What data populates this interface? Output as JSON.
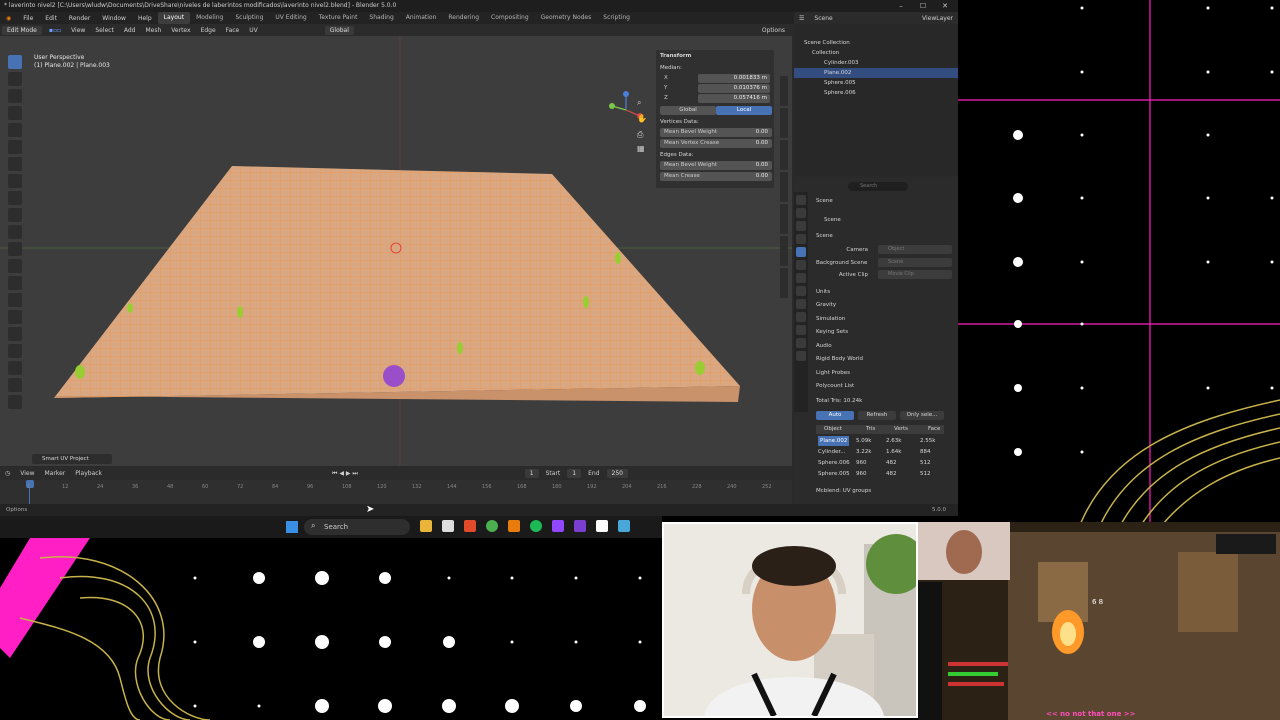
{
  "blender": {
    "title": "* laverinto nivel2 [C:\\Users\\wludw\\Documents\\DriveShare\\niveles de laberintos modificados\\laverinto nivel2.blend] - Blender 5.0.0",
    "menus": [
      "File",
      "Edit",
      "Render",
      "Window",
      "Help"
    ],
    "workspaces": [
      "Layout",
      "Modeling",
      "Sculpting",
      "UV Editing",
      "Texture Paint",
      "Shading",
      "Animation",
      "Rendering",
      "Compositing",
      "Geometry Nodes",
      "Scripting"
    ],
    "active_workspace": "Layout",
    "viewport_header": {
      "mode": "Edit Mode",
      "menus": [
        "View",
        "Select",
        "Add",
        "Mesh",
        "Vertex",
        "Edge",
        "Face",
        "UV"
      ],
      "transform_orientation": "Global",
      "options": "Options"
    },
    "viewport_info": {
      "line1": "User Perspective",
      "line2": "(1) Plane.002 | Plane.003"
    },
    "n_panel": {
      "header": "Transform",
      "median_label": "Median:",
      "x": "0.001833 m",
      "y": "0.010376 m",
      "z": "0.057416 m",
      "global": "Global",
      "local": "Local",
      "vertices_data": "Vertices Data:",
      "mean_bevel_weight_label": "Mean Bevel Weight",
      "mean_bevel_weight": "0.00",
      "mean_vertex_crease_label": "Mean Vertex Crease",
      "mean_vertex_crease": "0.00",
      "edges_data": "Edges Data:",
      "edge_bevel_weight_label": "Mean Bevel Weight",
      "edge_bevel_weight": "0.00",
      "mean_crease_label": "Mean Crease",
      "mean_crease": "0.00"
    },
    "smart_uv": "Smart UV Project",
    "timeline": {
      "menus": [
        "View",
        "Marker",
        "Playback"
      ],
      "current_frame": "1",
      "start_label": "Start",
      "start": "1",
      "end_label": "End",
      "end": "250",
      "ticks": [
        "1",
        "12",
        "24",
        "36",
        "48",
        "60",
        "72",
        "84",
        "96",
        "108",
        "120",
        "132",
        "144",
        "156",
        "168",
        "180",
        "192",
        "204",
        "216",
        "228",
        "240",
        "252"
      ]
    },
    "statusbar": {
      "left": "Options",
      "version": "5.0.0"
    },
    "outliner": {
      "scene_label": "Scene",
      "view_layer": "ViewLayer",
      "items": [
        {
          "label": "Scene Collection",
          "indent": 0
        },
        {
          "label": "Collection",
          "indent": 1
        },
        {
          "label": "Cylinder.003",
          "indent": 2
        },
        {
          "label": "Plane.002",
          "indent": 2,
          "selected": true
        },
        {
          "label": "Sphere.005",
          "indent": 2
        },
        {
          "label": "Sphere.006",
          "indent": 2
        }
      ]
    },
    "properties": {
      "search_placeholder": "Search",
      "breadcrumb": "Scene",
      "scene_name": "Scene",
      "section_scene": "Scene",
      "camera_label": "Camera",
      "camera_value": "Object",
      "background_label": "Background Scene",
      "background_value": "Scene",
      "active_clip_label": "Active Clip",
      "active_clip_value": "Movie Clip",
      "sections": [
        "Units",
        "Gravity",
        "Simulation",
        "Keying Sets",
        "Audio",
        "Rigid Body World",
        "Light Probes",
        "Polycount List"
      ],
      "total_tris": "Total Tris: 10.24k",
      "auto": "Auto",
      "refresh": "Refresh",
      "only_selected": "Only sele...",
      "table_headers": [
        "Object",
        "Tris",
        "Verts",
        "Face"
      ],
      "table_rows": [
        [
          "Plane.002",
          "5.09k",
          "2.63k",
          "2.55k"
        ],
        [
          "Cylinder...",
          "3.22k",
          "1.64k",
          "884"
        ],
        [
          "Sphere.006",
          "960",
          "482",
          "512"
        ],
        [
          "Sphere.005",
          "960",
          "482",
          "512"
        ]
      ],
      "mcblend": "Mcblend: UV groups"
    }
  },
  "taskbar": {
    "search_placeholder": "Search"
  },
  "stream": {
    "chat_message": "<< no not that one >>",
    "game_number": "6 8"
  },
  "colors": {
    "accent_blue": "#4772b3",
    "maze_orange": "#ff8c2a",
    "overlay_magenta": "#ff1fc4",
    "overlay_gold": "#c8b24a"
  }
}
